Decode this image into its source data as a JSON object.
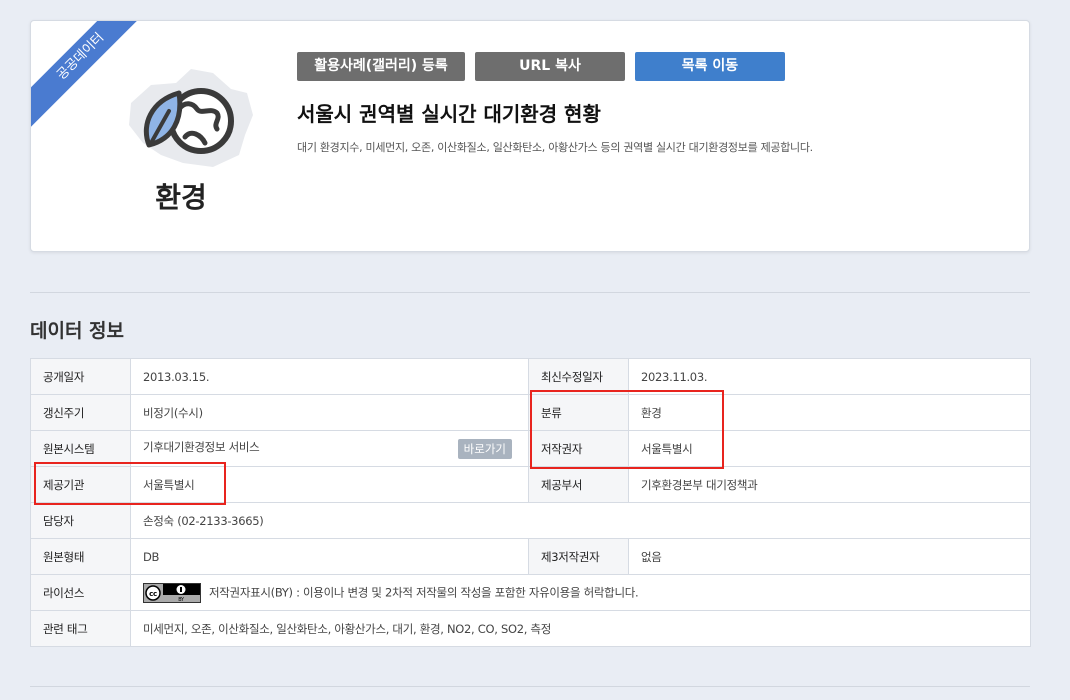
{
  "badge": "공공데이터",
  "category": {
    "label": "환경"
  },
  "buttons": {
    "gallery": "활용사례(갤러리) 등록",
    "url_copy": "URL 복사",
    "list": "목록 이동"
  },
  "dataset": {
    "title": "서울시 권역별 실시간 대기환경 현황",
    "description": "대기 환경지수, 미세먼지, 오존, 이산화질소, 일산화탄소, 아황산가스 등의 권역별 실시간 대기환경정보를 제공합니다."
  },
  "section_title": "데이터 정보",
  "info": {
    "open_date": {
      "label": "공개일자",
      "value": "2013.03.15."
    },
    "modified_date": {
      "label": "최신수정일자",
      "value": "2023.11.03."
    },
    "update_cycle": {
      "label": "갱신주기",
      "value": "비정기(수시)"
    },
    "classification": {
      "label": "분류",
      "value": "환경"
    },
    "source_system": {
      "label": "원본시스템",
      "value": "기후대기환경정보 서비스",
      "button": "바로가기"
    },
    "copyright_holder": {
      "label": "저작권자",
      "value": "서울특별시"
    },
    "provider": {
      "label": "제공기관",
      "value": "서울특별시"
    },
    "department": {
      "label": "제공부서",
      "value": "기후환경본부 대기정책과"
    },
    "manager": {
      "label": "담당자",
      "value": "손정숙 (02-2133-3665)"
    },
    "original_format": {
      "label": "원본형태",
      "value": "DB"
    },
    "third_party": {
      "label": "제3저작권자",
      "value": "없음"
    },
    "license": {
      "label": "라이선스",
      "value": "저작권자표시(BY) : 이용이나 변경 및 2차적 저작물의 작성을 포함한 자유이용을 허락합니다."
    },
    "tags": {
      "label": "관련 태그",
      "value": "미세먼지, 오존, 이산화질소, 일산화탄소, 아황산가스, 대기, 환경, NO2, CO, SO2, 측정"
    }
  },
  "colors": {
    "ribbon": "#4a7bd0",
    "button_gray": "#6e6e6e",
    "button_blue": "#3f7fcc",
    "highlight": "#e8241e"
  },
  "icons": [
    "earth-leaf-icon",
    "seoul-map-silhouette",
    "cc-by-license-icon"
  ]
}
